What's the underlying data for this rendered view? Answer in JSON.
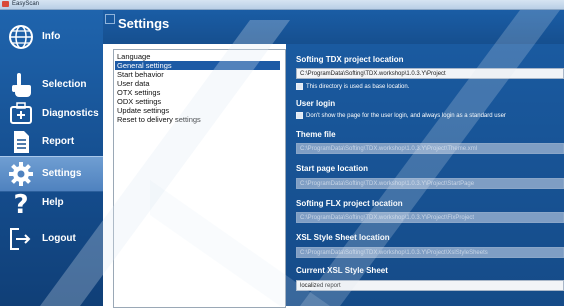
{
  "window": {
    "title": "EasyScan"
  },
  "sidebar": {
    "items": [
      {
        "label": "Info",
        "icon": "globe-icon"
      },
      {
        "label": "Selection",
        "icon": "hand-pointer-icon"
      },
      {
        "label": "Diagnostics",
        "icon": "diagnostics-plus-icon"
      },
      {
        "label": "Report",
        "icon": "document-icon"
      },
      {
        "label": "Settings",
        "icon": "gear-icon",
        "active": true
      },
      {
        "label": "Help",
        "icon": "question-icon"
      },
      {
        "label": "Logout",
        "icon": "logout-icon"
      }
    ]
  },
  "header": {
    "title": "Settings"
  },
  "settings_list": [
    "Language",
    "General settings",
    "Start behavior",
    "User data",
    "OTX settings",
    "ODX settings",
    "Update settings",
    "Reset to delivery settings"
  ],
  "selected_index": 1,
  "general": {
    "project_location_label": "Softing TDX project location",
    "project_location_value": "C:\\ProgramData\\Softing\\TDX.workshop\\1.0.3.Y\\Project",
    "base_location_option": "This directory is used as base location.",
    "user_login_label": "User login",
    "user_login_option": "Don't show the page for the user login, and always login as a standard user",
    "theme_label": "Theme file",
    "theme_value": "C:\\ProgramData\\Softing\\TDX.workshop\\1.0.3.Y\\Project\\Theme.xml",
    "start_page_label": "Start page location",
    "start_page_value": "C:\\ProgramData\\Softing\\TDX.workshop\\1.0.3.Y\\Project\\StartPage",
    "flx_label": "Softing FLX project location",
    "flx_value": "C:\\ProgramData\\Softing\\TDX.workshop\\1.0.3.Y\\Project\\FlxProject",
    "xsl_label": "XSL Style Sheet location",
    "xsl_value": "C:\\ProgramData\\Softing\\TDX.workshop\\1.0.3.Y\\Project\\XslStyleSheets",
    "current_xsl_label": "Current XSL Style Sheet",
    "current_xsl_value": "localized report"
  },
  "colors": {
    "sidebar": "#164f8f",
    "accent": "#1c5aa5",
    "active_item": "#5c8fcb",
    "watermark": "#c9d5e6"
  }
}
